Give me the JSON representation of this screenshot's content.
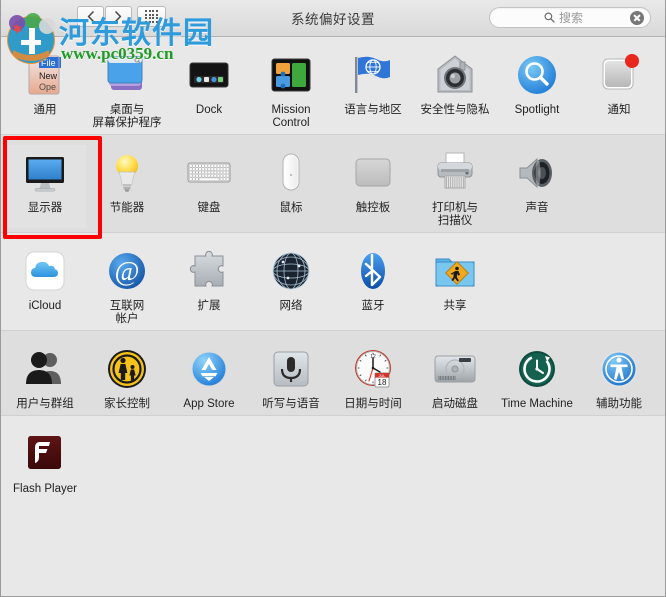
{
  "window": {
    "title": "系统偏好设置"
  },
  "toolbar": {
    "back_label": "后退",
    "forward_label": "前进",
    "showall_label": "显示全部"
  },
  "search": {
    "placeholder": "搜索",
    "value": "",
    "icon": "search-icon",
    "clear_label": "清除"
  },
  "watermark": {
    "site_name": "河东软件园",
    "url": "www.pc0359.cn"
  },
  "colors": {
    "highlight": "#fd0000",
    "window_bg": "#e8e8e8",
    "row_alt_bg": "#dedede",
    "title_text": "#3a3a3a",
    "badge_red": "#e8271d"
  },
  "panes": [
    {
      "row_index": 0,
      "alt": false,
      "items": [
        {
          "label": "通用",
          "icon": "general-icon"
        },
        {
          "label": "桌面与\n屏幕保护程序",
          "icon": "desktop-screensaver-icon"
        },
        {
          "label": "Dock",
          "icon": "dock-icon"
        },
        {
          "label": "Mission\nControl",
          "icon": "mission-control-icon"
        },
        {
          "label": "语言与地区",
          "icon": "language-region-icon"
        },
        {
          "label": "安全性与隐私",
          "icon": "security-privacy-icon"
        },
        {
          "label": "Spotlight",
          "icon": "spotlight-icon"
        },
        {
          "label": "通知",
          "icon": "notifications-icon",
          "badge": true
        }
      ]
    },
    {
      "row_index": 1,
      "alt": true,
      "items": [
        {
          "label": "显示器",
          "icon": "displays-icon",
          "highlighted": true
        },
        {
          "label": "节能器",
          "icon": "energy-saver-icon"
        },
        {
          "label": "键盘",
          "icon": "keyboard-icon"
        },
        {
          "label": "鼠标",
          "icon": "mouse-icon"
        },
        {
          "label": "触控板",
          "icon": "trackpad-icon"
        },
        {
          "label": "打印机与\n扫描仪",
          "icon": "printers-scanners-icon"
        },
        {
          "label": "声音",
          "icon": "sound-icon"
        }
      ]
    },
    {
      "row_index": 2,
      "alt": false,
      "items": [
        {
          "label": "iCloud",
          "icon": "icloud-icon"
        },
        {
          "label": "互联网\n帐户",
          "icon": "internet-accounts-icon"
        },
        {
          "label": "扩展",
          "icon": "extensions-icon"
        },
        {
          "label": "网络",
          "icon": "network-icon"
        },
        {
          "label": "蓝牙",
          "icon": "bluetooth-icon"
        },
        {
          "label": "共享",
          "icon": "sharing-icon"
        }
      ]
    },
    {
      "row_index": 3,
      "alt": true,
      "items": [
        {
          "label": "用户与群组",
          "icon": "users-groups-icon"
        },
        {
          "label": "家长控制",
          "icon": "parental-controls-icon"
        },
        {
          "label": "App Store",
          "icon": "app-store-icon"
        },
        {
          "label": "听写与语音",
          "icon": "dictation-speech-icon"
        },
        {
          "label": "日期与时间",
          "icon": "date-time-icon",
          "month": "JUL",
          "day": "18"
        },
        {
          "label": "启动磁盘",
          "icon": "startup-disk-icon"
        },
        {
          "label": "Time Machine",
          "icon": "time-machine-icon"
        },
        {
          "label": "辅助功能",
          "icon": "accessibility-icon"
        }
      ]
    },
    {
      "row_index": 4,
      "alt": false,
      "items": [
        {
          "label": "Flash Player",
          "icon": "flash-player-icon"
        }
      ]
    }
  ]
}
